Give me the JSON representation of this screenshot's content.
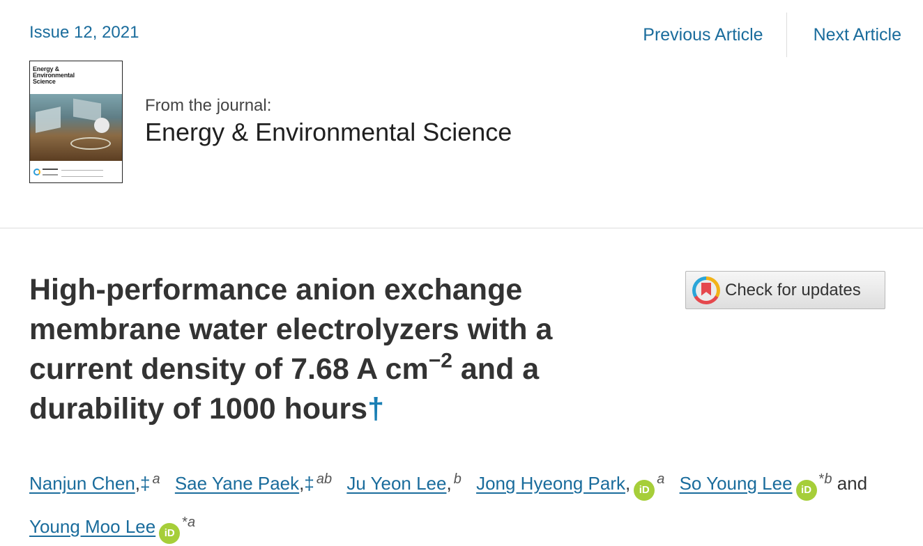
{
  "issue": {
    "label": "Issue 12, 2021"
  },
  "nav": {
    "previous": "Previous Article",
    "next": "Next Article"
  },
  "journal": {
    "from_label": "From the journal:",
    "name": "Energy & Environmental Science",
    "cover_title_line1": "Energy &",
    "cover_title_line2": "Environmental",
    "cover_title_line3": "Science"
  },
  "article": {
    "title_part1": "High-performance anion exchange membrane water electrolyzers with a current density of 7.68 A cm",
    "title_sup": "−2",
    "title_part2": " and a durability of 1000 hours",
    "title_dagger": "†"
  },
  "check_updates": {
    "label": "Check for updates"
  },
  "authors": [
    {
      "name": "Nanjun Chen",
      "marks": ",‡",
      "aff": "a",
      "orcid": false
    },
    {
      "name": "Sae Yane Paek",
      "marks": ",‡",
      "aff": "ab",
      "orcid": false
    },
    {
      "name": "Ju Yeon Lee",
      "marks": ",",
      "aff": "b",
      "orcid": false
    },
    {
      "name": "Jong Hyeong Park",
      "marks": ",",
      "aff": "a",
      "orcid": true
    },
    {
      "name": "So Young Lee",
      "marks": "*",
      "aff": "b",
      "orcid": true
    },
    {
      "name": "Young Moo Lee",
      "marks": "*",
      "aff": "a",
      "orcid": true
    }
  ],
  "authors_and": "and",
  "orcid_glyph": "iD",
  "colors": {
    "link": "#1a6c9c",
    "orcid": "#a6ce39",
    "text": "#333333"
  }
}
